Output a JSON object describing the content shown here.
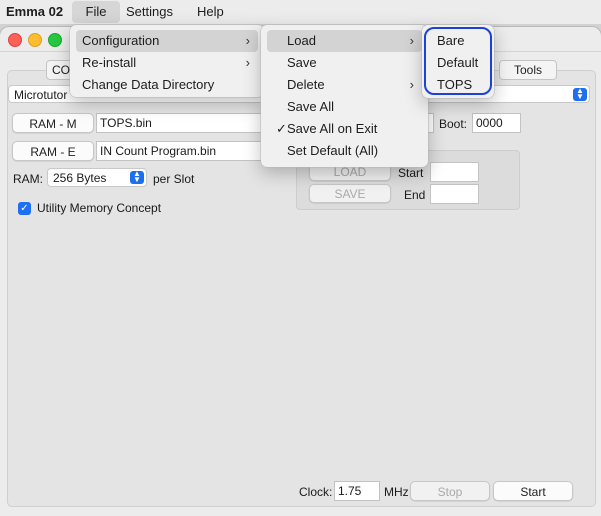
{
  "menubar": {
    "app": "Emma 02",
    "items": [
      "File",
      "Settings",
      "Help"
    ]
  },
  "tabs": [
    "CO",
    "Tools"
  ],
  "computer_select": "Microtutor",
  "ram_m": {
    "button": "RAM - M",
    "file": "TOPS.bin"
  },
  "ram_e": {
    "button": "RAM - E",
    "file": "IN Count Program.bin"
  },
  "ram": {
    "label": "RAM:",
    "value": "256 Bytes",
    "suffix": "per Slot"
  },
  "boot": {
    "label": "Boot:",
    "value": "0000"
  },
  "utility": {
    "label": "Utility Memory Concept",
    "checked": true
  },
  "memory_box": {
    "load": "LOAD",
    "save": "SAVE",
    "start_label": "Start",
    "end_label": "End"
  },
  "bottom": {
    "clock_label": "Clock:",
    "clock_value": "1.75",
    "unit": "MHz",
    "stop": "Stop",
    "start": "Start"
  },
  "file_menu": {
    "items": [
      "Configuration",
      "Re-install",
      "Change Data Directory"
    ]
  },
  "config_menu": {
    "items": [
      "Load",
      "Save",
      "Delete",
      "Save All",
      "Save All on Exit",
      "Set Default (All)"
    ]
  },
  "load_menu": {
    "items": [
      "Bare",
      "Default",
      "TOPS"
    ]
  }
}
